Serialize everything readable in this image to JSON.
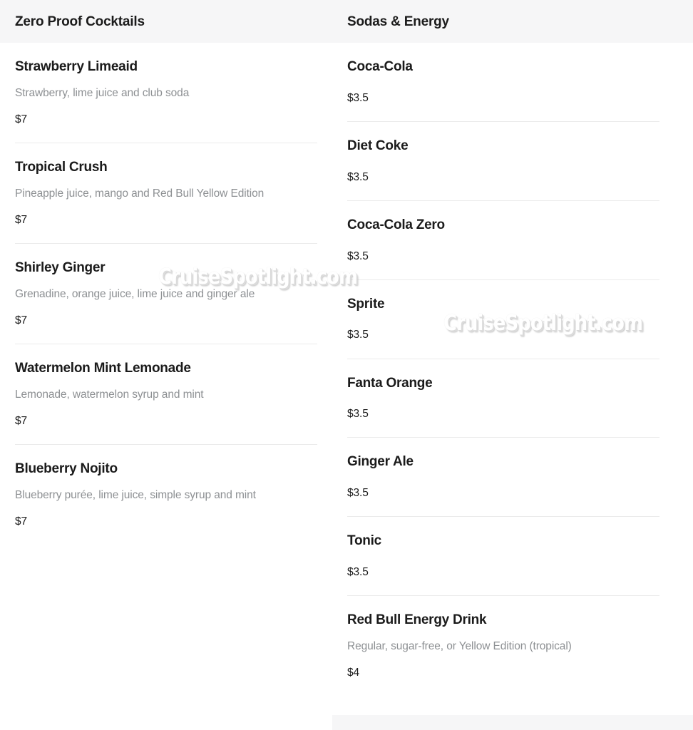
{
  "board": {
    "watermark_text": "CruiseSpotlight.com",
    "header_bg": "#f6f6f7",
    "card_bg": "#ffffff",
    "divider_color": "#ebebeb",
    "title_color": "#1b1b1b",
    "desc_color": "#8d9093"
  },
  "sections": [
    {
      "title": "Zero Proof Cocktails",
      "items": [
        {
          "name": "Strawberry Limeaid",
          "desc": "Strawberry, lime juice and club soda",
          "price": "$7"
        },
        {
          "name": "Tropical Crush",
          "desc": "Pineapple juice, mango and Red Bull Yellow Edition",
          "price": "$7"
        },
        {
          "name": "Shirley Ginger",
          "desc": "Grenadine, orange juice, lime juice and ginger ale",
          "price": "$7"
        },
        {
          "name": "Watermelon Mint Lemonade",
          "desc": "Lemonade, watermelon syrup and mint",
          "price": "$7"
        },
        {
          "name": "Blueberry Nojito",
          "desc": "Blueberry purée, lime juice, simple syrup and mint",
          "price": "$7"
        }
      ]
    },
    {
      "title": "Sodas & Energy",
      "items": [
        {
          "name": "Coca-Cola",
          "desc": "",
          "price": "$3.5"
        },
        {
          "name": "Diet Coke",
          "desc": "",
          "price": "$3.5"
        },
        {
          "name": "Coca-Cola Zero",
          "desc": "",
          "price": "$3.5"
        },
        {
          "name": "Sprite",
          "desc": "",
          "price": "$3.5"
        },
        {
          "name": "Fanta Orange",
          "desc": "",
          "price": "$3.5"
        },
        {
          "name": "Ginger Ale",
          "desc": "",
          "price": "$3.5"
        },
        {
          "name": "Tonic",
          "desc": "",
          "price": "$3.5"
        },
        {
          "name": "Red Bull Energy Drink",
          "desc": "Regular, sugar-free, or Yellow Edition (tropical)",
          "price": "$4"
        }
      ]
    }
  ]
}
